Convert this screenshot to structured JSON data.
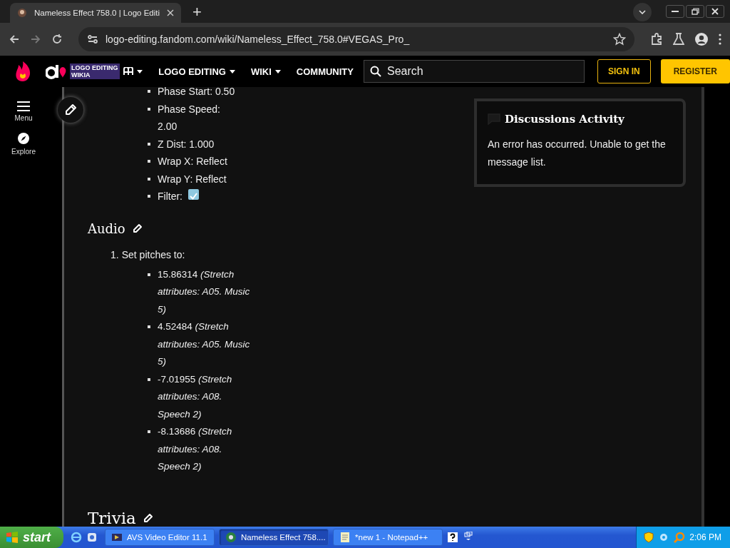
{
  "browser": {
    "tab": {
      "title": "Nameless Effect 758.0 | Logo Editi",
      "selected": true
    },
    "new_tab": "+",
    "address": "logo-editing.fandom.com/wiki/Nameless_Effect_758.0#VEGAS_Pro_"
  },
  "site_header": {
    "logo_lines": [
      "LOGO EDITING",
      "WIKIA"
    ],
    "nav": [
      "LOGO EDITING",
      "WIKI",
      "COMMUNITY"
    ],
    "search_placeholder": "Search",
    "sign_in": "SIGN IN",
    "register": "REGISTER"
  },
  "rail": [
    {
      "label": "Menu",
      "kind": "menu"
    },
    {
      "label": "Explore",
      "kind": "explore"
    }
  ],
  "properties": [
    {
      "text": "Phase Start: 0.50",
      "kind": "text"
    },
    {
      "text": "Phase Speed: 2.00",
      "kind": "text"
    },
    {
      "text": "Z Dist: 1.000",
      "kind": "text"
    },
    {
      "text": "Wrap X: Reflect",
      "kind": "text"
    },
    {
      "text": "Wrap Y: Reflect",
      "kind": "text"
    },
    {
      "text": "Filter:",
      "kind": "check",
      "checked": true
    }
  ],
  "sections": [
    {
      "heading": "Audio",
      "steps": [
        {
          "number": "1.",
          "text": "Set pitches to:",
          "items": [
            "15.86314 *(Stretch attributes: A05. Music 5)*",
            "4.52484 *(Stretch attributes: A05. Music 5)*",
            "-7.01955 *(Stretch attributes: A08. Speech 2)*",
            "-8.13686 *(Stretch attributes: A08. Speech 2)*"
          ]
        }
      ]
    },
    {
      "heading": "Trivia"
    }
  ],
  "discussions": {
    "title": "Discussions Activity",
    "message": "An error has occurred. Unable to get the message list."
  },
  "taskbar": {
    "start": "start",
    "tasks": [
      {
        "label": "AVS Video Editor 11.1",
        "selected": false,
        "kind": "video"
      },
      {
        "label": "Nameless Effect 758....",
        "selected": true,
        "kind": "browser"
      },
      {
        "label": "*new 1 - Notepad++",
        "selected": false,
        "kind": "notepad"
      }
    ],
    "clock": "2:06 PM"
  }
}
